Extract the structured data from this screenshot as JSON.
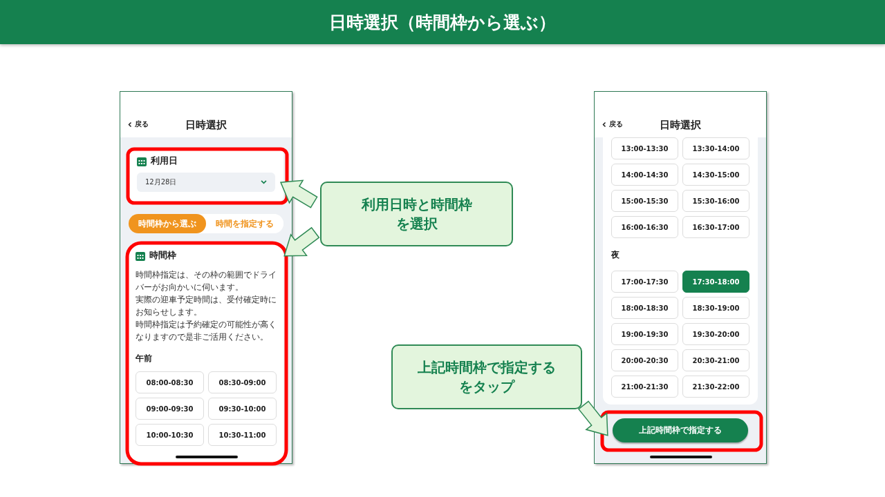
{
  "slide_title": "日時選択（時間枠から選ぶ）",
  "left_phone": {
    "nav": {
      "back": "戻る",
      "title": "日時選択"
    },
    "date_card": {
      "label": "利用日",
      "value": "12月28日"
    },
    "mode_tabs": [
      {
        "label": "時間枠から選ぶ",
        "selected": true
      },
      {
        "label": "時間を指定する",
        "selected": false
      }
    ],
    "slot_card": {
      "title": "時間枠",
      "notes": [
        "時間枠指定は、その枠の範囲でドライバーがお向かいに伺います。",
        "実際の迎車予定時間は、受付確定時にお知らせします。",
        "時間枠指定は予約確定の可能性が高くなりますので是非ご活用ください。"
      ],
      "sections": [
        {
          "heading": "午前",
          "slots": [
            {
              "label": "08:00-08:30",
              "selected": false
            },
            {
              "label": "08:30-09:00",
              "selected": false
            },
            {
              "label": "09:00-09:30",
              "selected": false
            },
            {
              "label": "09:30-10:00",
              "selected": false
            },
            {
              "label": "10:00-10:30",
              "selected": false
            },
            {
              "label": "10:30-11:00",
              "selected": false
            }
          ]
        }
      ]
    }
  },
  "right_phone": {
    "nav": {
      "back": "戻る",
      "title": "日時選択"
    },
    "sections": [
      {
        "slots": [
          {
            "label": "13:00-13:30",
            "selected": false
          },
          {
            "label": "13:30-14:00",
            "selected": false
          },
          {
            "label": "14:00-14:30",
            "selected": false
          },
          {
            "label": "14:30-15:00",
            "selected": false
          },
          {
            "label": "15:00-15:30",
            "selected": false
          },
          {
            "label": "15:30-16:00",
            "selected": false
          },
          {
            "label": "16:00-16:30",
            "selected": false
          },
          {
            "label": "16:30-17:00",
            "selected": false
          }
        ]
      },
      {
        "heading": "夜",
        "slots": [
          {
            "label": "17:00-17:30",
            "selected": false
          },
          {
            "label": "17:30-18:00",
            "selected": true
          },
          {
            "label": "18:00-18:30",
            "selected": false
          },
          {
            "label": "18:30-19:00",
            "selected": false
          },
          {
            "label": "19:00-19:30",
            "selected": false
          },
          {
            "label": "19:30-20:00",
            "selected": false
          },
          {
            "label": "20:00-20:30",
            "selected": false
          },
          {
            "label": "20:30-21:00",
            "selected": false
          },
          {
            "label": "21:00-21:30",
            "selected": false
          },
          {
            "label": "21:30-22:00",
            "selected": false
          }
        ]
      }
    ],
    "confirm_button": "上記時間枠で指定する"
  },
  "callouts": [
    {
      "lines": [
        "利用日時と時間枠",
        "を選択"
      ]
    },
    {
      "lines": [
        "上記時間枠で指定する",
        "をタップ"
      ]
    }
  ]
}
